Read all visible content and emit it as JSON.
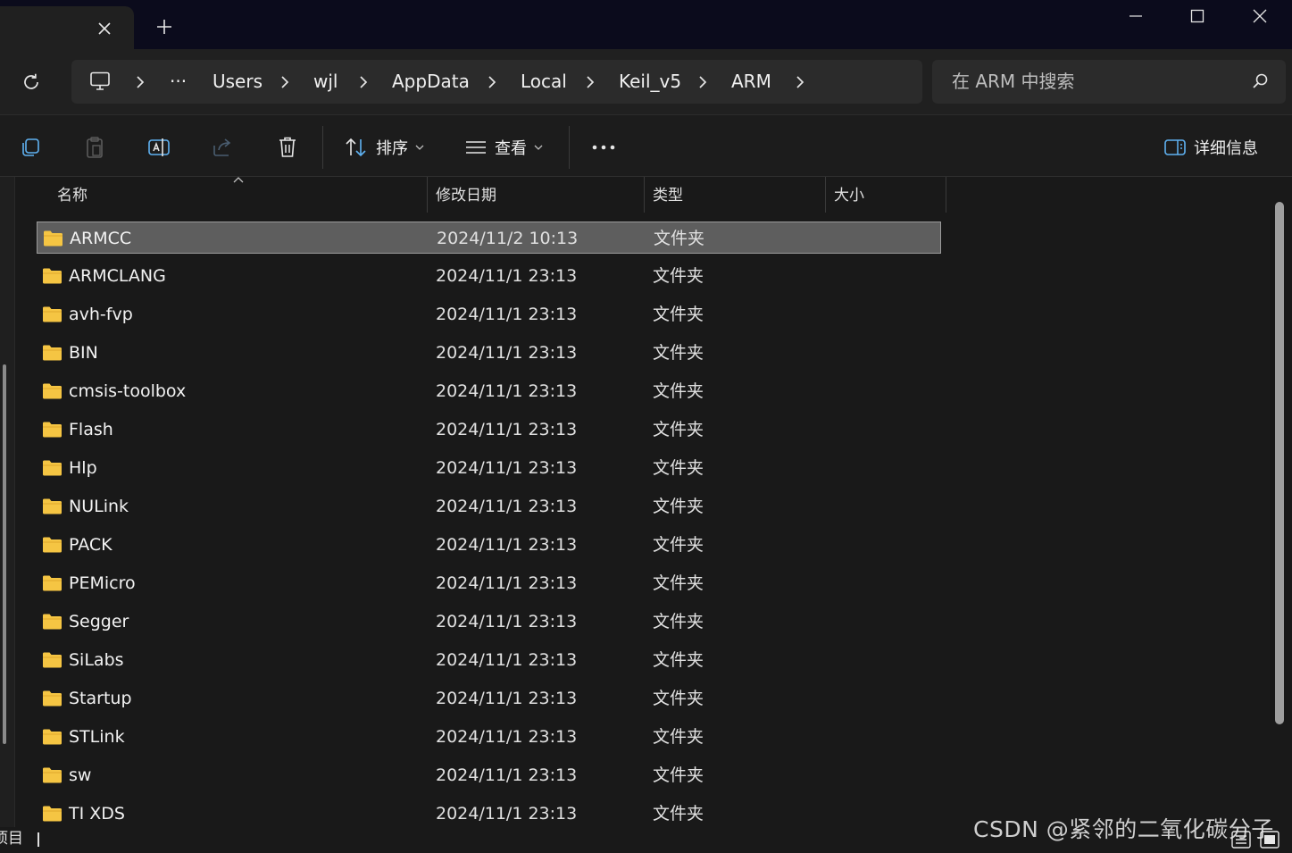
{
  "titlebar": {
    "tab_close": "close-icon",
    "new_tab": "plus-icon",
    "controls": [
      "minimize",
      "maximize",
      "close"
    ]
  },
  "breadcrumb": {
    "items": [
      "Users",
      "wjl",
      "AppData",
      "Local",
      "Keil_v5",
      "ARM"
    ],
    "overflow": "···"
  },
  "search": {
    "placeholder": "在 ARM 中搜索"
  },
  "toolbar": {
    "sort_label": "排序",
    "view_label": "查看",
    "more_label": "···",
    "details_label": "详细信息"
  },
  "columns": {
    "name": "名称",
    "modified": "修改日期",
    "type": "类型",
    "size": "大小"
  },
  "files": [
    {
      "name": "ARMCC",
      "modified": "2024/11/2 10:13",
      "type": "文件夹",
      "selected": true
    },
    {
      "name": "ARMCLANG",
      "modified": "2024/11/1 23:13",
      "type": "文件夹"
    },
    {
      "name": "avh-fvp",
      "modified": "2024/11/1 23:13",
      "type": "文件夹"
    },
    {
      "name": "BIN",
      "modified": "2024/11/1 23:13",
      "type": "文件夹"
    },
    {
      "name": "cmsis-toolbox",
      "modified": "2024/11/1 23:13",
      "type": "文件夹"
    },
    {
      "name": "Flash",
      "modified": "2024/11/1 23:13",
      "type": "文件夹"
    },
    {
      "name": "Hlp",
      "modified": "2024/11/1 23:13",
      "type": "文件夹"
    },
    {
      "name": "NULink",
      "modified": "2024/11/1 23:13",
      "type": "文件夹"
    },
    {
      "name": "PACK",
      "modified": "2024/11/1 23:13",
      "type": "文件夹"
    },
    {
      "name": "PEMicro",
      "modified": "2024/11/1 23:13",
      "type": "文件夹"
    },
    {
      "name": "Segger",
      "modified": "2024/11/1 23:13",
      "type": "文件夹"
    },
    {
      "name": "SiLabs",
      "modified": "2024/11/1 23:13",
      "type": "文件夹"
    },
    {
      "name": "Startup",
      "modified": "2024/11/1 23:13",
      "type": "文件夹"
    },
    {
      "name": "STLink",
      "modified": "2024/11/1 23:13",
      "type": "文件夹"
    },
    {
      "name": "sw",
      "modified": "2024/11/1 23:13",
      "type": "文件夹"
    },
    {
      "name": "TI XDS",
      "modified": "2024/11/1 23:13",
      "type": "文件夹"
    }
  ],
  "status": {
    "text": "项目"
  },
  "watermark": "CSDN @紧邻的二氧化碳分子",
  "colors": {
    "folder": "#f5c543",
    "selected_bg": "#5e5e5e",
    "background": "#191919"
  }
}
